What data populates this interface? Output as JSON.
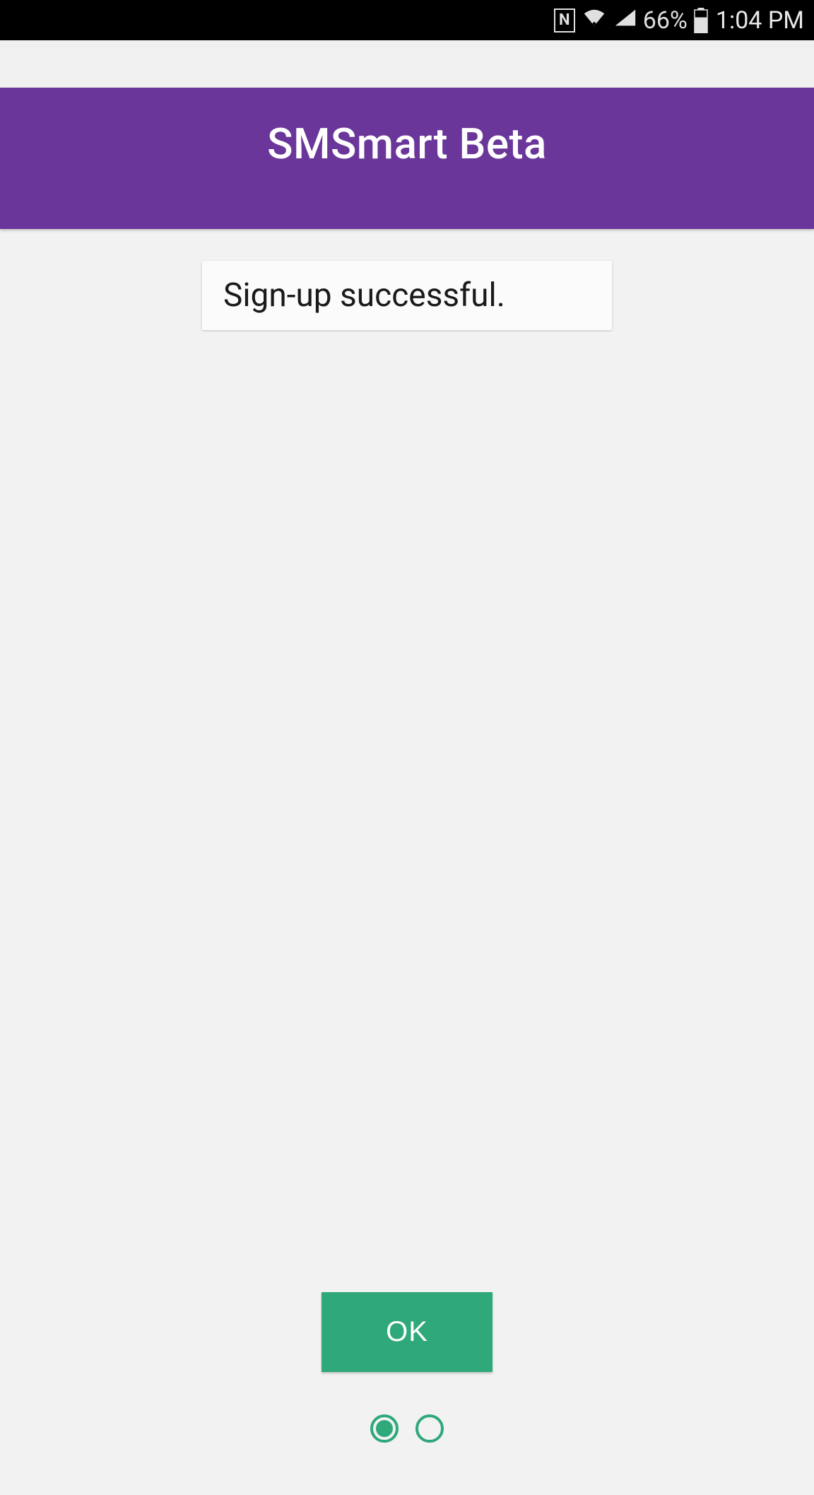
{
  "status_bar": {
    "battery_percent": "66%",
    "time": "1:04 PM"
  },
  "header": {
    "title": "SMSmart Beta"
  },
  "message": {
    "text": "Sign-up successful."
  },
  "actions": {
    "ok_label": "OK"
  },
  "pagination": {
    "total": 2,
    "active": 0
  }
}
